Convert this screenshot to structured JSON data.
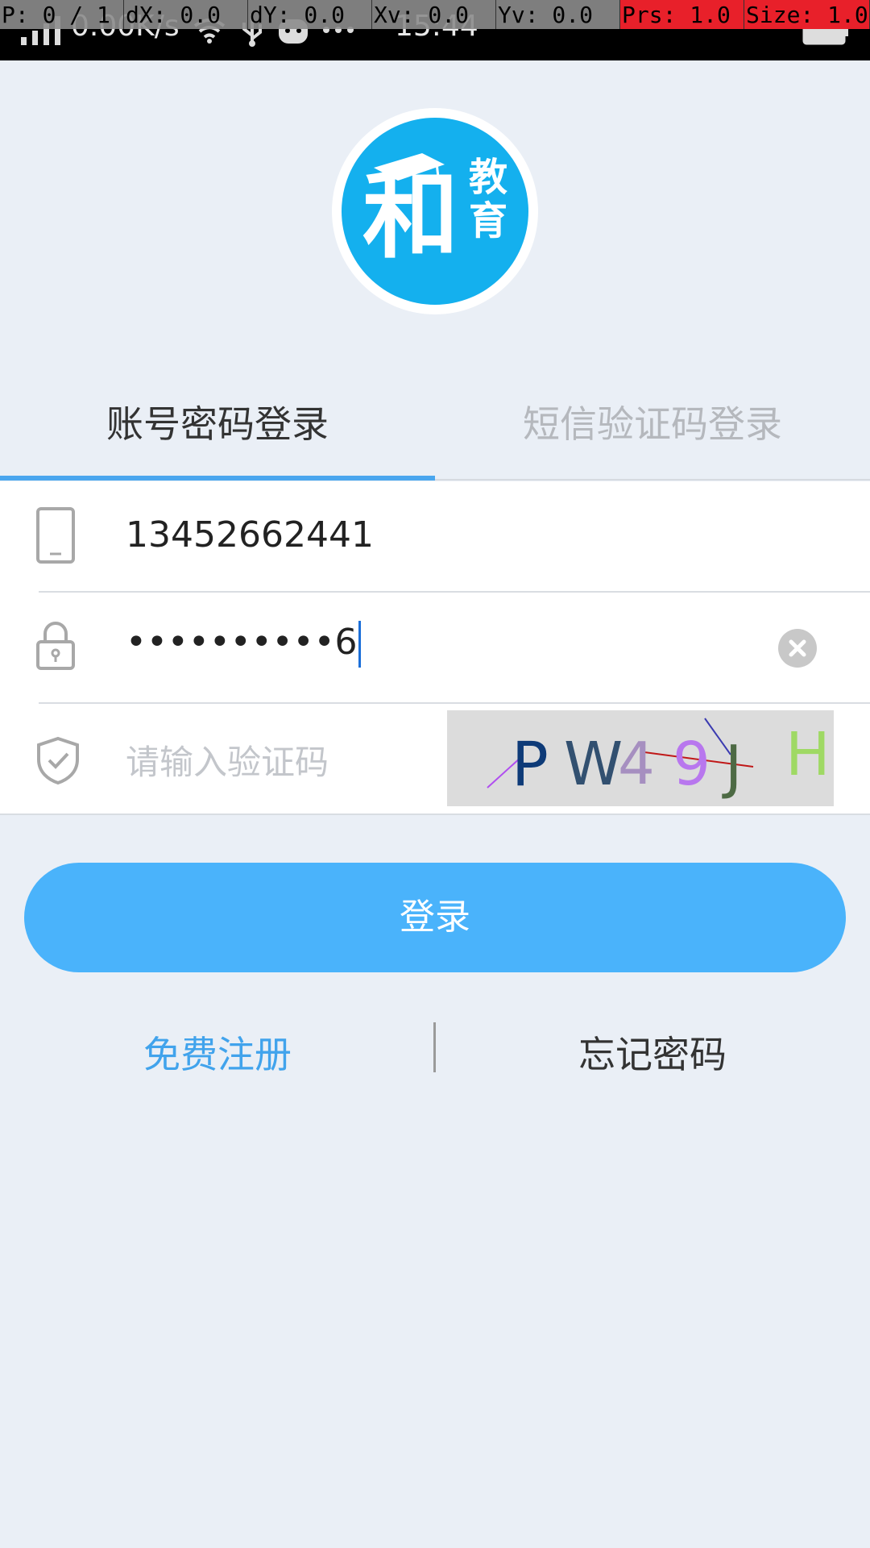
{
  "debug_overlay": {
    "pointer": "P: 0 / 1",
    "dx": "dX: 0.0",
    "dy": "dY: 0.0",
    "xv": "Xv: 0.0",
    "yv": "Yv: 0.0",
    "prs": "Prs: 1.0",
    "size": "Size: 1.0"
  },
  "status_bar": {
    "network_speed": "0.00K/s",
    "time": "15:44",
    "icons": [
      "signal-icon",
      "wifi-icon",
      "usb-icon",
      "app-notification-icon",
      "more-dots-icon",
      "battery-icon"
    ]
  },
  "logo": {
    "text_main": "和",
    "text_side_1": "教",
    "text_side_2": "育"
  },
  "tabs": [
    {
      "label": "账号密码登录",
      "active": true
    },
    {
      "label": "短信验证码登录",
      "active": false
    }
  ],
  "form": {
    "phone": {
      "value": "13452662441",
      "icon": "phone-icon"
    },
    "password": {
      "value": "••••••••••6",
      "icon": "lock-icon"
    },
    "captcha": {
      "placeholder": "请输入验证码",
      "icon": "shield-check-icon",
      "image_text": [
        "P",
        "W",
        "4",
        "9",
        "J",
        "H"
      ]
    }
  },
  "login_button": "登录",
  "links": {
    "register": "免费注册",
    "forgot": "忘记密码"
  },
  "colors": {
    "accent": "#4ab3fb",
    "tab_underline": "#4aa6ee",
    "logo_blue": "#14b0ee",
    "register_link": "#41a3ec"
  }
}
